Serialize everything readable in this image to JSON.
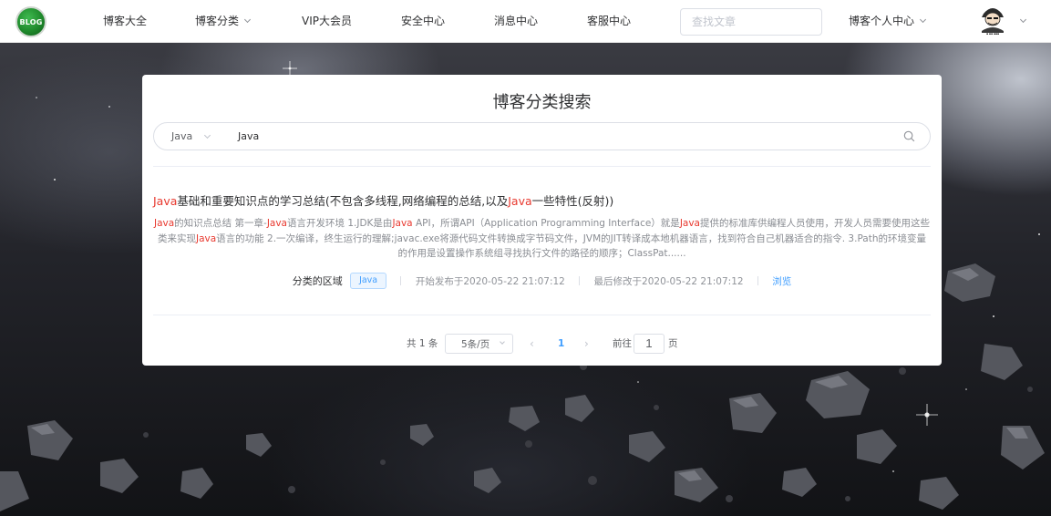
{
  "nav": {
    "logo_text": "BLOG",
    "items": [
      "博客大全",
      "博客分类",
      "VIP大会员",
      "安全中心",
      "消息中心",
      "客服中心"
    ],
    "search_placeholder": "查找文章",
    "personal_center": "博客个人中心"
  },
  "card": {
    "title": "博客分类搜索",
    "category": "Java",
    "keyword": "Java"
  },
  "result": {
    "title_parts": [
      "Java",
      "基础和重要知识点的学习总结(不包含多线程,网络编程的总结,以及",
      "Java",
      "一些特性(反射))"
    ],
    "summary_parts": [
      "Java",
      "的知识点总结 第一章-",
      "Java",
      "语言开发环境 1.JDK是由",
      "Java",
      " API，所谓API（Application Programming Interface）就是",
      "Java",
      "提供的标准库供编程人员使用，开发人员需要使用这些类来实现",
      "Java",
      "语言的功能 2.一次编译，终生运行的理解;javac.exe将源代码文件转换成字节码文件，JVM的JIT转译成本地机器语言，找到符合自己机器适合的指令. 3.Path的环境变量的作用是设置操作系统组寻找执行文件的路径的顺序；ClassPat......"
    ],
    "meta_label": "分类的区域",
    "tag": "Java",
    "published": "开始发布于2020-05-22 21:07:12",
    "modified": "最后修改于2020-05-22 21:07:12",
    "browse": "浏览"
  },
  "pagination": {
    "total": "共 1 条",
    "page_size": "5条/页",
    "current_page": "1",
    "goto_label": "前往",
    "goto_value": "1",
    "page_unit": "页"
  },
  "colors": {
    "highlight": "#e8392f",
    "accent": "#409eff"
  }
}
